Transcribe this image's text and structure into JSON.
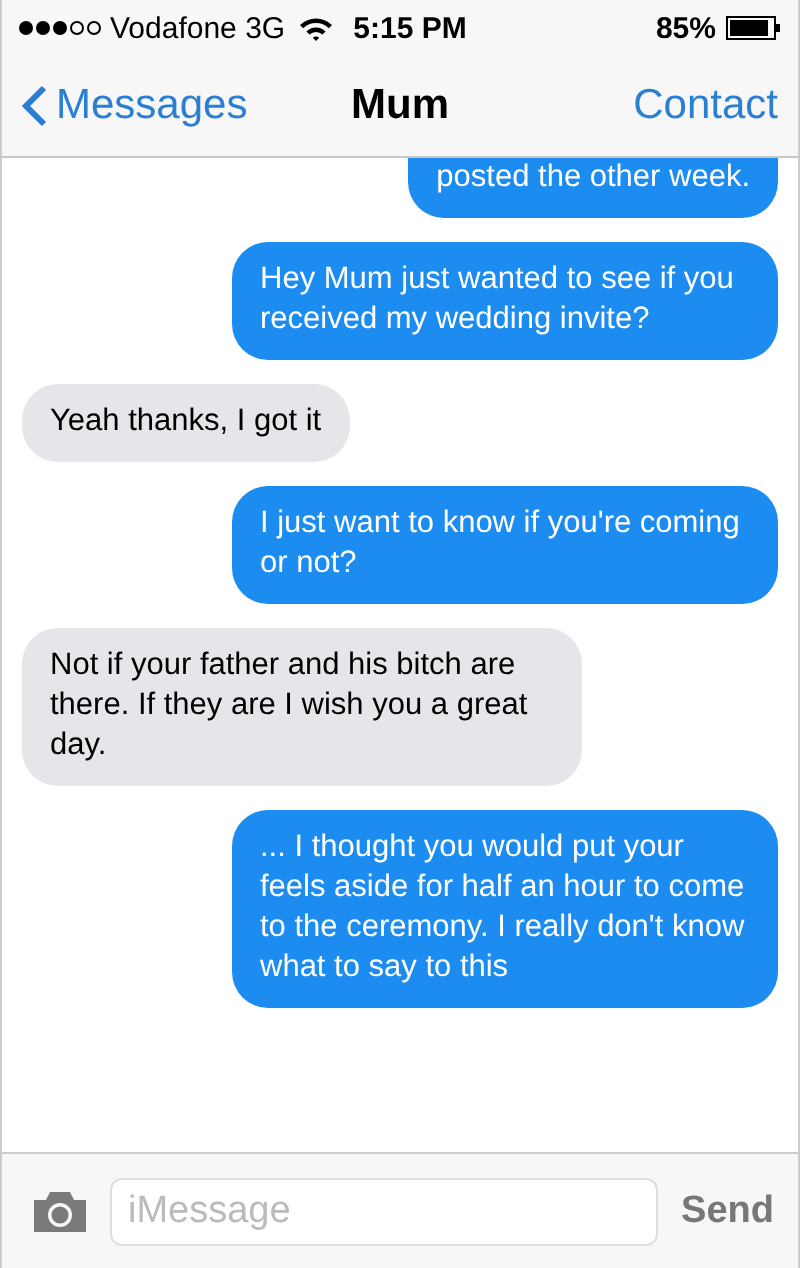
{
  "status_bar": {
    "carrier": "Vodafone 3G",
    "time": "5:15 PM",
    "battery": "85%"
  },
  "nav": {
    "back": "Messages",
    "title": "Mum",
    "action": "Contact"
  },
  "messages": [
    {
      "kind": "sent",
      "text": "posted the other week."
    },
    {
      "kind": "sent",
      "text": "Hey Mum just wanted to see if you received my wedding invite?"
    },
    {
      "kind": "received",
      "text": "Yeah thanks, I got it"
    },
    {
      "kind": "sent",
      "text": "I just want to know if you're coming or not?"
    },
    {
      "kind": "received",
      "text": "Not if your father and his bitch are there. If they are I wish you a great day."
    },
    {
      "kind": "sent",
      "text": "... I thought you would put your feels aside for half an hour to come to the ceremony. I really don't know what to say to this"
    }
  ],
  "composer": {
    "placeholder": "iMessage",
    "send": "Send"
  }
}
